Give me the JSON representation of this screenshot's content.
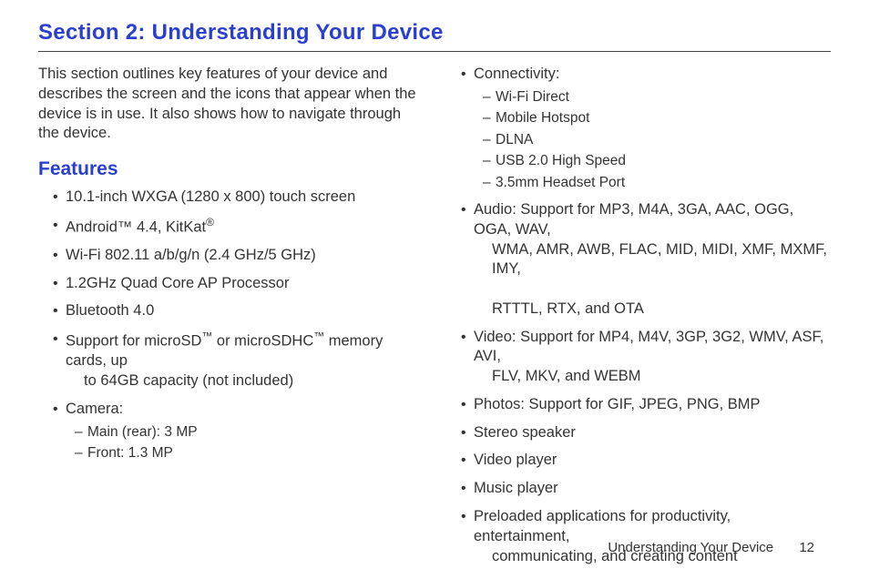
{
  "section_title": "Section 2: Understanding Your Device",
  "intro": "This section outlines key features of your device and describes the screen and the icons that appear when the device is in use. It also shows how to navigate through the device.",
  "features_heading": "Features",
  "left_features": [
    {
      "type": "plain",
      "text": "10.1-inch WXGA (1280 x 800) touch screen"
    },
    {
      "type": "html",
      "html": "Android™ 4.4, KitKat<span class='tm'>®</span>"
    },
    {
      "type": "plain",
      "text": "Wi-Fi 802.11 a/b/g/n (2.4 GHz/5 GHz)"
    },
    {
      "type": "plain",
      "text": "1.2GHz Quad Core AP Processor"
    },
    {
      "type": "plain",
      "text": "Bluetooth 4.0"
    },
    {
      "type": "html",
      "html": "Support for microSD<span class='tm'>™</span> or microSDHC<span class='tm'>™</span> memory cards, up<br><span class='wrap'>to 64GB capacity (not included)</span>"
    },
    {
      "type": "group",
      "label": "Camera:",
      "subs": [
        "Main (rear): 3 MP",
        "Front: 1.3 MP"
      ]
    }
  ],
  "right_features": [
    {
      "type": "group",
      "label": "Connectivity:",
      "subs": [
        "Wi-Fi Direct",
        "Mobile Hotspot",
        "DLNA",
        "USB 2.0 High Speed",
        "3.5mm Headset Port"
      ]
    },
    {
      "type": "html",
      "html": "Audio: Support for MP3, M4A, 3GA, AAC, OGG, OGA, WAV,<br><span class='wrap'>WMA, AMR, AWB, FLAC, MID, MIDI, XMF, MXMF, IMY,</span><br><span class='wrap'>RTTTL, RTX, and OTA</span>"
    },
    {
      "type": "html",
      "html": "Video: Support for MP4, M4V, 3GP, 3G2, WMV, ASF, AVI,<br><span class='wrap'>FLV, MKV, and WEBM</span>"
    },
    {
      "type": "plain",
      "text": "Photos: Support for GIF, JPEG, PNG, BMP"
    },
    {
      "type": "plain",
      "text": "Stereo speaker"
    },
    {
      "type": "plain",
      "text": "Video player"
    },
    {
      "type": "plain",
      "text": "Music player"
    },
    {
      "type": "html",
      "html": "Preloaded applications for productivity, entertainment,<br><span class='wrap'>communicating, and creating content</span>"
    }
  ],
  "footer_text": "Understanding Your Device",
  "page_number": "12"
}
